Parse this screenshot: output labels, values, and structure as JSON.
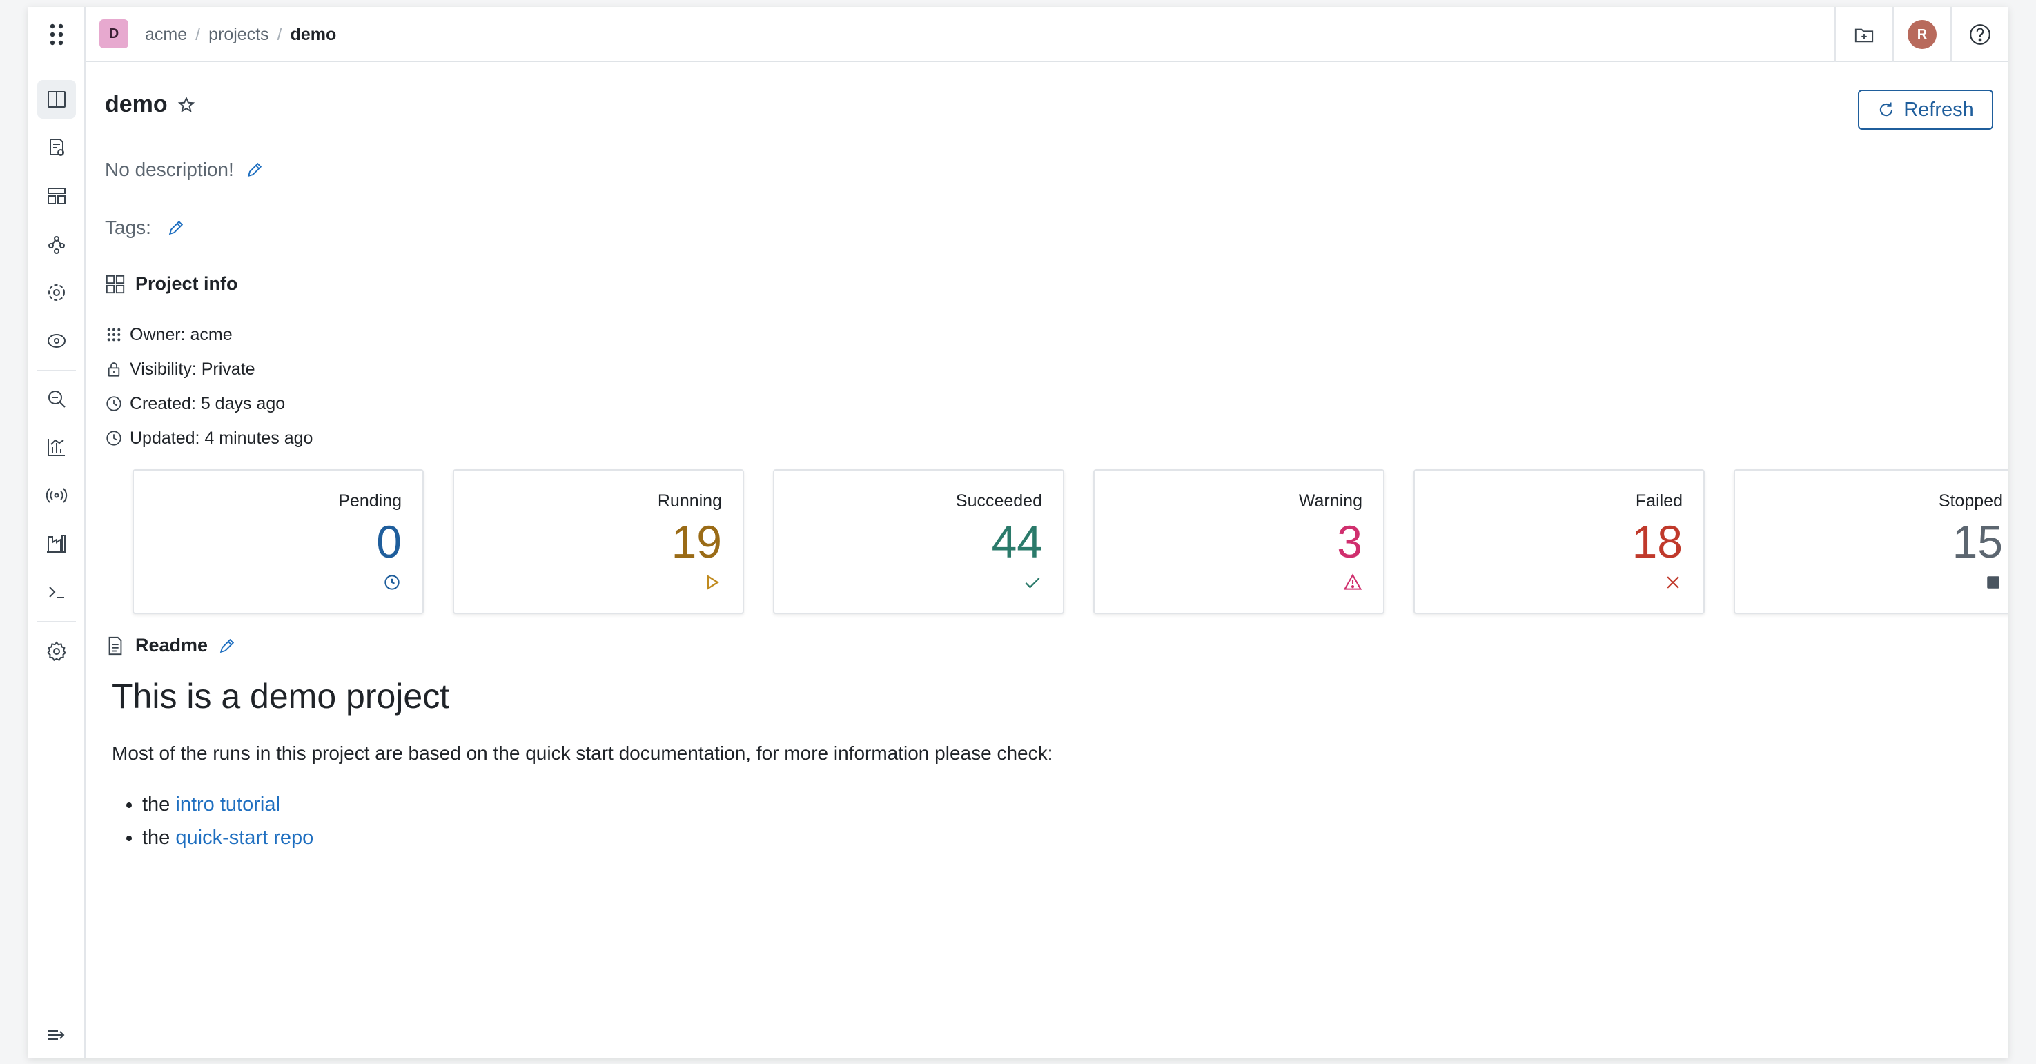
{
  "header": {
    "project_avatar": "D",
    "breadcrumb": [
      "acme",
      "projects",
      "demo"
    ],
    "user_avatar": "R",
    "icons": [
      "new-folder-icon",
      "help-icon"
    ]
  },
  "sidebar": {
    "items": [
      {
        "name": "overview",
        "icon": "panels-icon",
        "active": true
      },
      {
        "name": "runs",
        "icon": "file-settings-icon"
      },
      {
        "name": "dashboards",
        "icon": "layout-icon"
      },
      {
        "name": "graph",
        "icon": "nodes-icon"
      },
      {
        "name": "components",
        "icon": "hub-icon"
      },
      {
        "name": "models",
        "icon": "target-icon"
      },
      {
        "name": "search",
        "icon": "search-icon"
      },
      {
        "name": "analytics",
        "icon": "chart-icon"
      },
      {
        "name": "agents",
        "icon": "broadcast-icon"
      },
      {
        "name": "registry",
        "icon": "factory-icon"
      },
      {
        "name": "terminal",
        "icon": "terminal-icon"
      },
      {
        "name": "settings",
        "icon": "gear-icon"
      }
    ],
    "collapse_icon": "collapse-icon"
  },
  "page": {
    "title": "demo",
    "refresh_label": "Refresh",
    "description": "No description!",
    "tags_label": "Tags:",
    "info_title": "Project info",
    "info": {
      "owner": "Owner: acme",
      "visibility": "Visibility: Private",
      "created": "Created: 5 days ago",
      "updated": "Updated: 4 minutes ago"
    }
  },
  "stats": [
    {
      "label": "Pending",
      "value": "0",
      "color": "#1f5e9c",
      "icon": "clock-icon"
    },
    {
      "label": "Running",
      "value": "19",
      "color": "#9a6b16",
      "icon": "play-icon"
    },
    {
      "label": "Succeeded",
      "value": "44",
      "color": "#2a7a6a",
      "icon": "check-icon"
    },
    {
      "label": "Warning",
      "value": "3",
      "color": "#d02f6e",
      "icon": "warning-icon"
    },
    {
      "label": "Failed",
      "value": "18",
      "color": "#c0392b",
      "icon": "close-icon"
    },
    {
      "label": "Stopped",
      "value": "15",
      "color": "#5c6670",
      "icon": "stop-icon"
    }
  ],
  "readme": {
    "title": "Readme",
    "heading": "This is a demo project",
    "paragraph": "Most of the runs in this project are based on the quick start documentation, for more information please check:",
    "list": [
      {
        "prefix": "the ",
        "link": "intro tutorial"
      },
      {
        "prefix": "the ",
        "link": "quick-start repo"
      }
    ]
  }
}
